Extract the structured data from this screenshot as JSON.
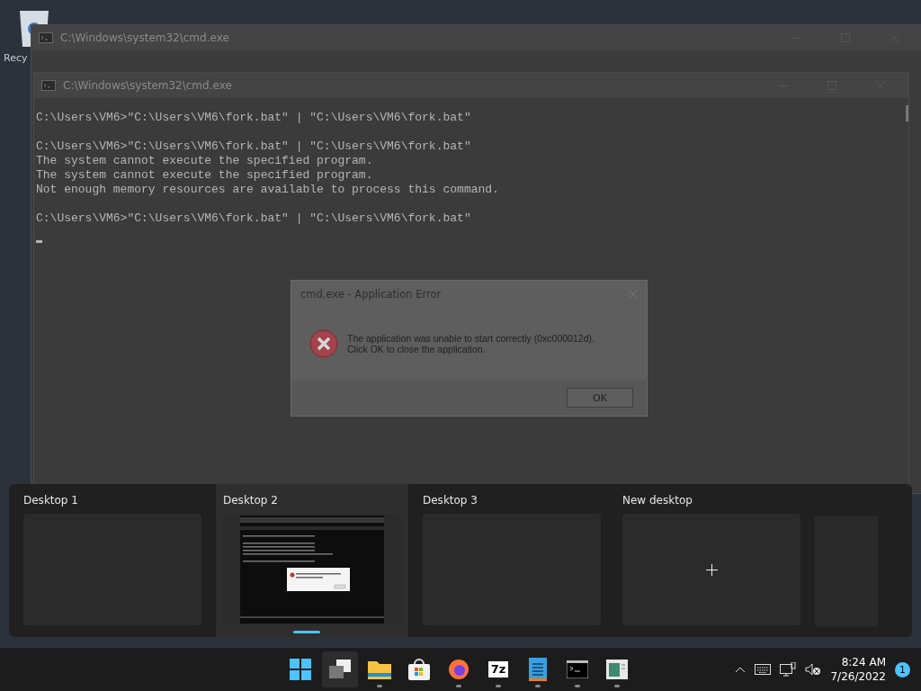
{
  "desktop": {
    "icons": [
      {
        "label": "Recy"
      }
    ]
  },
  "windows": [
    {
      "title": "C:\\Windows\\system32\\cmd.exe"
    },
    {
      "title": "C:\\Windows\\system32\\cmd.exe",
      "paragraphs": [
        [
          "C:\\Users\\VM6>\"C:\\Users\\VM6\\fork.bat\" | \"C:\\Users\\VM6\\fork.bat\""
        ],
        [
          "C:\\Users\\VM6>\"C:\\Users\\VM6\\fork.bat\" | \"C:\\Users\\VM6\\fork.bat\"",
          "The system cannot execute the specified program.",
          "The system cannot execute the specified program.",
          "Not enough memory resources are available to process this command."
        ],
        [
          "C:\\Users\\VM6>\"C:\\Users\\VM6\\fork.bat\" | \"C:\\Users\\VM6\\fork.bat\""
        ]
      ]
    }
  ],
  "dialog": {
    "title": "cmd.exe - Application Error",
    "message": [
      "The application was unable to start correctly (0xc000012d).",
      "Click OK to close the application."
    ],
    "button": "OK"
  },
  "task_view": {
    "desktops": [
      {
        "label": "Desktop 1",
        "kind": "empty",
        "selected": false
      },
      {
        "label": "Desktop 2",
        "kind": "preview",
        "selected": true
      },
      {
        "label": "Desktop 3",
        "kind": "empty",
        "selected": false
      },
      {
        "label": "New desktop",
        "kind": "new",
        "selected": false
      }
    ]
  },
  "taskbar": {
    "apps": [
      {
        "kind": "start",
        "running": false,
        "selected": false
      },
      {
        "kind": "taskview",
        "running": false,
        "selected": true
      },
      {
        "kind": "explorer",
        "running": true,
        "selected": false
      },
      {
        "kind": "store",
        "running": false,
        "selected": false
      },
      {
        "kind": "firefox",
        "running": true,
        "selected": false
      },
      {
        "kind": "sevenzip",
        "label": "7z",
        "running": true,
        "selected": false
      },
      {
        "kind": "notepad",
        "running": true,
        "selected": false
      },
      {
        "kind": "terminal",
        "running": true,
        "selected": false
      },
      {
        "kind": "app",
        "running": true,
        "selected": false
      }
    ],
    "time": "8:24 AM",
    "date": "7/26/2022",
    "notifications": "1"
  }
}
